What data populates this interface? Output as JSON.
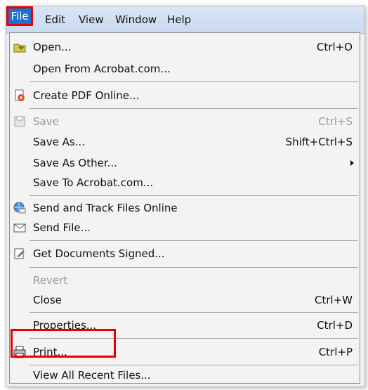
{
  "menubar": {
    "file": "File",
    "edit": "Edit",
    "view": "View",
    "window": "Window",
    "help": "Help"
  },
  "menu": {
    "items": [
      {
        "label": "Open...",
        "shortcut": "Ctrl+O",
        "icon": "open-folder-icon"
      },
      {
        "label": "Open From Acrobat.com...",
        "shortcut": ""
      },
      {
        "label": "Create PDF Online...",
        "shortcut": "",
        "icon": "create-pdf-icon"
      },
      {
        "label": "Save",
        "shortcut": "Ctrl+S",
        "icon": "save-icon",
        "disabled": true
      },
      {
        "label": "Save As...",
        "shortcut": "Shift+Ctrl+S"
      },
      {
        "label": "Save As Other...",
        "shortcut": "",
        "submenu": true
      },
      {
        "label": "Save To Acrobat.com...",
        "shortcut": ""
      },
      {
        "label": "Send and Track Files Online",
        "shortcut": "",
        "icon": "globe-send-icon"
      },
      {
        "label": "Send File...",
        "shortcut": "",
        "icon": "envelope-icon"
      },
      {
        "label": "Get Documents Signed...",
        "shortcut": "",
        "icon": "sign-document-icon"
      },
      {
        "label": "Revert",
        "shortcut": "",
        "disabled": true
      },
      {
        "label": "Close",
        "shortcut": "Ctrl+W"
      },
      {
        "label": "Properties...",
        "shortcut": "Ctrl+D"
      },
      {
        "label": "Print...",
        "shortcut": "Ctrl+P",
        "icon": "printer-icon"
      },
      {
        "label": "View All Recent Files...",
        "shortcut": ""
      }
    ]
  },
  "colors": {
    "highlight": "#e80000",
    "file_menu_bg": "#1f6fd1",
    "menu_bg": "#f3f3f3"
  }
}
